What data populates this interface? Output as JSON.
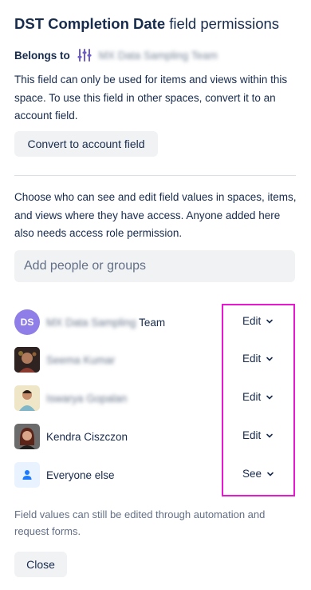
{
  "header": {
    "field_name": "DST Completion Date",
    "title_suffix": "field permissions"
  },
  "belongs": {
    "label": "Belongs to",
    "space_name": "MX Data Sampling Team",
    "space_icon": "sliders-icon",
    "space_icon_color": "#6e5dc6"
  },
  "description": "This field can only be used for items and views within this space. To use this field in other spaces, convert it to an account field.",
  "convert_button": "Convert to account field",
  "access_description": "Choose who can see and edit field values in spaces, items, and views where they have access. Anyone added here also needs access role permission.",
  "search": {
    "placeholder": "Add people or groups"
  },
  "people": [
    {
      "name_blurred": "MX Data Sampling",
      "name_suffix": "Team",
      "avatar_initials": "DS",
      "permission": "Edit"
    },
    {
      "name_blurred": "Seema Kumar",
      "name_suffix": "",
      "avatar": "photo",
      "permission": "Edit"
    },
    {
      "name_blurred": "Iswarya Gopalan",
      "name_suffix": "",
      "avatar": "photo",
      "permission": "Edit"
    },
    {
      "name": "Kendra Ciszczon",
      "avatar": "photo",
      "permission": "Edit"
    },
    {
      "name": "Everyone else",
      "avatar": "person-icon",
      "permission": "See"
    }
  ],
  "footnote": "Field values can still be edited through automation and request forms.",
  "close_button": "Close",
  "colors": {
    "highlight": "#e619d1",
    "avatar_initials_bg": "#8f7ee7",
    "everyone_avatar_bg": "#e9f2ff",
    "person_icon": "#1d7afc"
  }
}
